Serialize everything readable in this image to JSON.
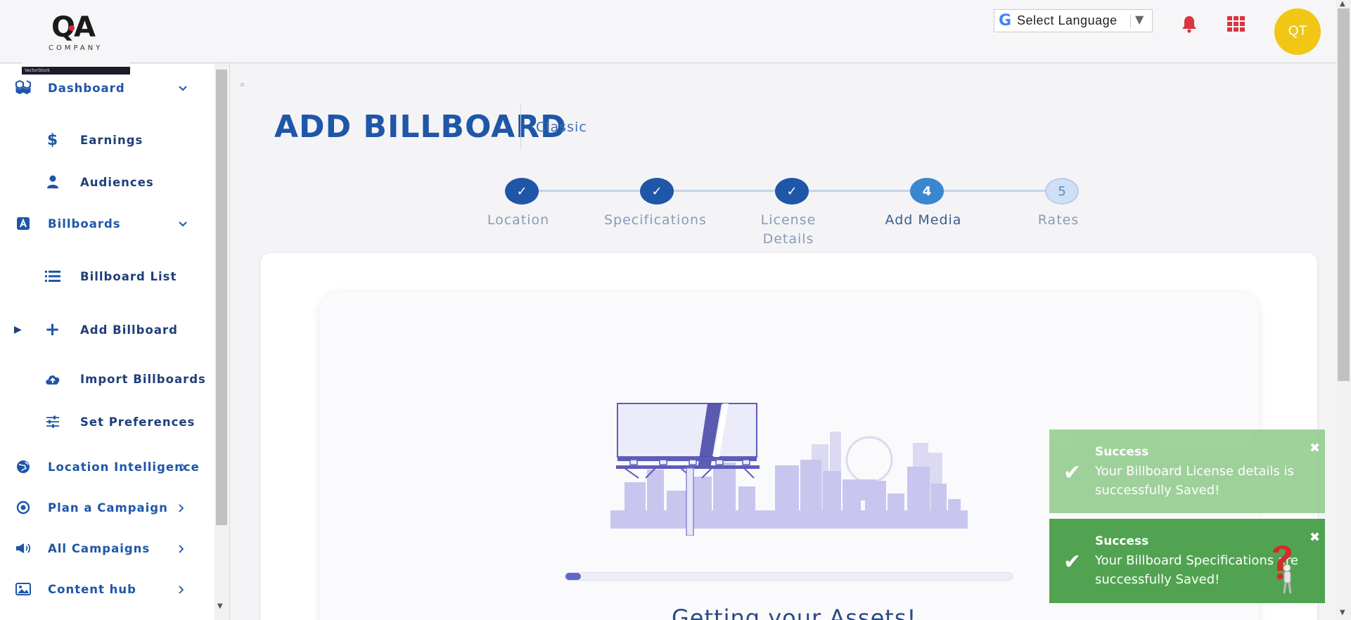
{
  "header": {
    "logo_text": "QA",
    "logo_sub": "COMPANY",
    "logo_strip": "VectorStock",
    "language_label": "Select Language",
    "avatar_initials": "QT",
    "colors": {
      "bell": "#d9343f",
      "apps": "#d9343f",
      "avatar": "#f2c614"
    }
  },
  "sidebar": {
    "items": [
      {
        "label": "Dashboard",
        "icon": "cubes-icon",
        "chevron": "down"
      },
      {
        "label": "Earnings",
        "icon": "dollar-icon",
        "sub": true
      },
      {
        "label": "Audiences",
        "icon": "user-icon",
        "sub": true
      },
      {
        "label": "Billboards",
        "icon": "billboard-a-icon",
        "chevron": "down"
      },
      {
        "label": "Billboard List",
        "icon": "list-icon",
        "sub": true
      },
      {
        "label": "Add Billboard",
        "icon": "plus-icon",
        "sub": true,
        "current": true
      },
      {
        "label": "Import Billboards",
        "icon": "cloud-upload-icon",
        "sub": true
      },
      {
        "label": "Set Preferences",
        "icon": "sliders-icon",
        "sub": true
      },
      {
        "label": "Location Intelligence",
        "icon": "globe-icon",
        "chevron": "right"
      },
      {
        "label": "Plan a Campaign",
        "icon": "target-icon",
        "chevron": "right"
      },
      {
        "label": "All Campaigns",
        "icon": "megaphone-icon",
        "chevron": "right"
      },
      {
        "label": "Content hub",
        "icon": "image-icon",
        "chevron": "right"
      }
    ]
  },
  "page": {
    "title": "ADD BILLBOARD",
    "subtitle": "Classic"
  },
  "stepper": {
    "steps": [
      {
        "number": "✓",
        "label": "Location",
        "state": "done"
      },
      {
        "number": "✓",
        "label": "Specifications",
        "state": "done"
      },
      {
        "number": "✓",
        "label": "License Details",
        "state": "done"
      },
      {
        "number": "4",
        "label": "Add Media",
        "state": "active"
      },
      {
        "number": "5",
        "label": "Rates",
        "state": "todo"
      }
    ]
  },
  "media": {
    "progress_fraction": 0.035,
    "loading_text": "Getting your Assets!"
  },
  "toasts": [
    {
      "title": "Success",
      "message": "Your Billboard License details is successfully Saved!"
    },
    {
      "title": "Success",
      "message": "Your Billboard Specifications are successfully Saved!"
    }
  ]
}
